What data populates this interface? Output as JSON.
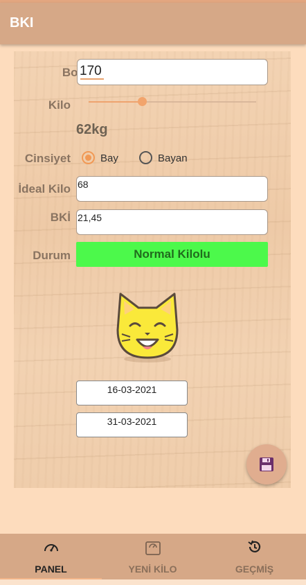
{
  "appbar": {
    "title": "BKI"
  },
  "form": {
    "boy_label": "Boy",
    "boy_value": "170",
    "kilo_label": "Kilo",
    "kilo_slider_fraction": 0.32,
    "kilo_display": "62kg",
    "cinsiyet_label": "Cinsiyet",
    "gender_options": [
      "Bay",
      "Bayan"
    ],
    "gender_selected": "Bay",
    "ideal_label": "İdeal Kilo",
    "ideal_value": "68",
    "bki_label": "BKİ",
    "bki_value": "21,45",
    "durum_label": "Durum",
    "durum_value": "Normal Kilolu",
    "durum_color": "#4cf94b"
  },
  "dates": {
    "start": "16-03-2021",
    "end": "31-03-2021"
  },
  "fab": {
    "icon": "save-icon"
  },
  "bottom_nav": [
    {
      "label": "PANEL",
      "icon": "speedometer-icon",
      "active": true
    },
    {
      "label": "YENİ KİLO",
      "icon": "scale-icon",
      "active": false
    },
    {
      "label": "GEÇMİŞ",
      "icon": "history-icon",
      "active": false
    }
  ],
  "colors": {
    "accent": "#f19955",
    "appbar": "#d6a887",
    "background": "#fddcbd"
  }
}
